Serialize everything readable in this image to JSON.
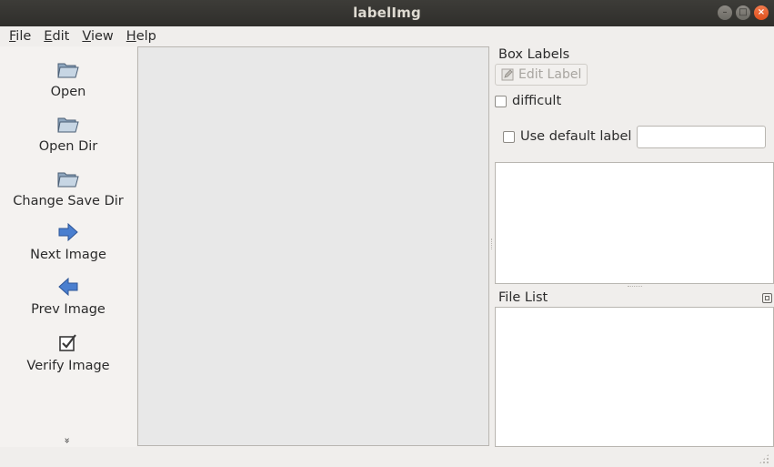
{
  "window": {
    "title": "labelImg"
  },
  "menu": [
    {
      "label": "File"
    },
    {
      "label": "Edit"
    },
    {
      "label": "View"
    },
    {
      "label": "Help"
    }
  ],
  "toolbar": {
    "tools": [
      {
        "label": "Open",
        "icon": "folder-icon"
      },
      {
        "label": "Open Dir",
        "icon": "folder-icon"
      },
      {
        "label": "Change Save Dir",
        "icon": "folder-icon"
      },
      {
        "label": "Next Image",
        "icon": "arrow-right-icon"
      },
      {
        "label": "Prev Image",
        "icon": "arrow-left-icon"
      },
      {
        "label": "Verify Image",
        "icon": "checkbox-checked-icon"
      }
    ],
    "more_glyph": "»"
  },
  "box_labels": {
    "title": "Box Labels",
    "edit_label_button": "Edit Label",
    "difficult_label": "difficult",
    "difficult_checked": false,
    "use_default_label": "Use default label",
    "use_default_checked": false,
    "default_label_value": ""
  },
  "file_list": {
    "title": "File List"
  },
  "colors": {
    "titlebar": "#2f2e2b",
    "close_button": "#e0501d",
    "canvas": "#e8e8e8",
    "arrow_blue": "#3f75c4"
  }
}
